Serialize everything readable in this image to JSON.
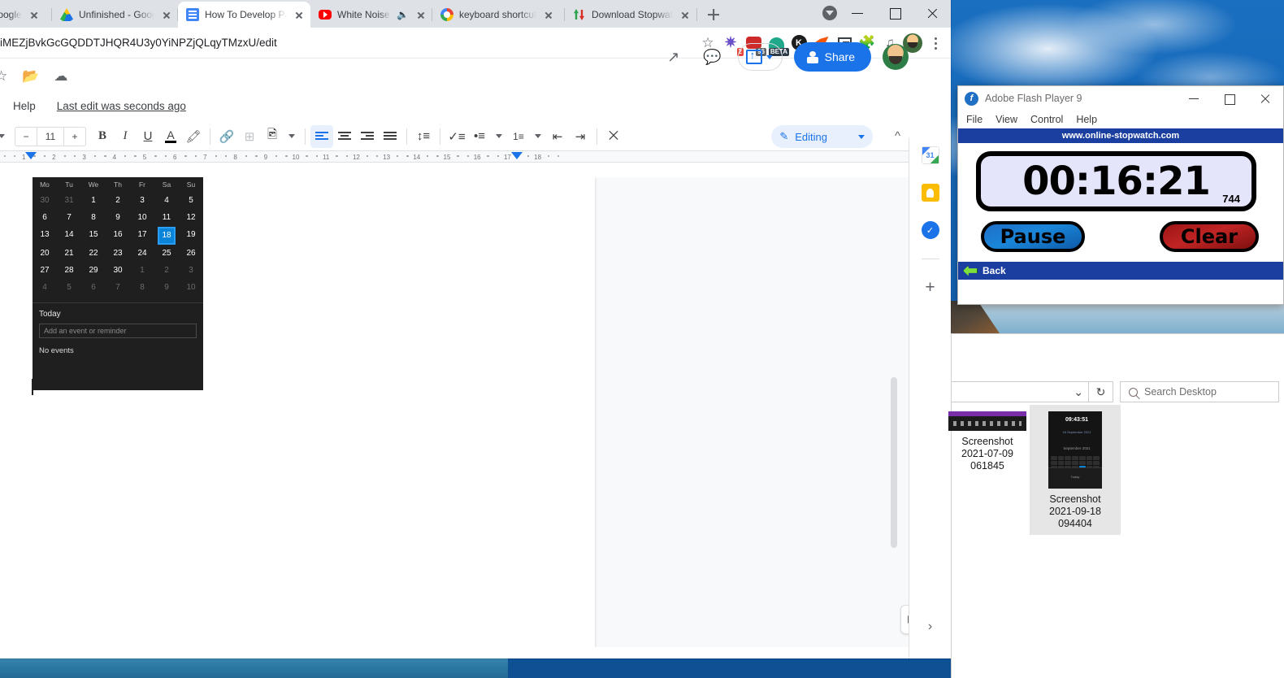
{
  "browser": {
    "tabs": [
      {
        "title": "rive - Google",
        "favicon": "none",
        "active": false
      },
      {
        "title": "Unfinished - Googl",
        "favicon": "google-drive-icon",
        "active": false
      },
      {
        "title": "How To Develop Pa",
        "favicon": "google-docs-icon",
        "active": true
      },
      {
        "title": "White Noise Bl",
        "favicon": "youtube-icon",
        "active": false,
        "audio": true
      },
      {
        "title": "keyboard shortcut",
        "favicon": "google-icon",
        "active": false
      },
      {
        "title": "Download Stopwat",
        "favicon": "download-icon",
        "active": false
      }
    ],
    "new_tab_label": "+",
    "url": "iMEZjBvkGcGQDDTJHQR4U3y0YiNPZjQLqyTMzxU/edit",
    "extensions": [
      {
        "name": "star-icon",
        "glyph": "☆",
        "color": "#5f6368"
      },
      {
        "name": "snowflake-extension-icon",
        "glyph": "✹",
        "color": "#6b4fc9",
        "badge": "2",
        "badge_color": "#e8453c"
      },
      {
        "name": "grammar-extension-icon",
        "glyph": "",
        "color": "#cf2a2a",
        "badge": "96",
        "badge_color": "#5f6368"
      },
      {
        "name": "beta-extension-icon",
        "glyph": "",
        "color": "#1fa88a",
        "badge": "BETA",
        "badge_color": "#2d3a4a"
      },
      {
        "name": "kami-extension-icon",
        "glyph": "K",
        "color": "#1c1c1c"
      },
      {
        "name": "orange-pin-extension-icon",
        "glyph": "",
        "color": "#f4560a"
      },
      {
        "name": "picture-in-picture-icon",
        "glyph": "",
        "color": "#3c4043"
      },
      {
        "name": "puzzle-extensions-icon",
        "glyph": "",
        "color": "#5f6368"
      },
      {
        "name": "playlist-icon",
        "glyph": "",
        "color": "#5f6368"
      },
      {
        "name": "profile-avatar",
        "glyph": "",
        "color": "#f0b429"
      },
      {
        "name": "chrome-menu-icon",
        "glyph": "",
        "color": "#5f6368"
      }
    ]
  },
  "docs": {
    "header_icons": [
      "star-icon",
      "move-to-folder-icon",
      "cloud-saved-icon"
    ],
    "menu": {
      "help": "Help",
      "last_edit": "Last edit was seconds ago"
    },
    "header_right": {
      "activity_label": "activity-dashboard",
      "comment_label": "comment-history",
      "upload_label": "upload",
      "share_label": "Share"
    },
    "toolbar": {
      "font_size": "11",
      "minus": "−",
      "plus": "+",
      "bold": "B",
      "italic": "I",
      "underline": "U",
      "text_color": "A",
      "highlight": "highlight-icon",
      "link": "link-icon",
      "comment": "add-comment-icon",
      "image": "insert-image-icon",
      "align_left": "align-left-icon",
      "align_center": "align-center-icon",
      "align_right": "align-right-icon",
      "align_justify": "align-justify-icon",
      "line_spacing": "line-spacing-icon",
      "checklist": "checklist-icon",
      "bullet_list": "bulleted-list-icon",
      "numbered_list": "numbered-list-icon",
      "indent_less": "decrease-indent-icon",
      "indent_more": "increase-indent-icon",
      "clear_format": "clear-formatting-icon"
    },
    "mode": {
      "label": "Editing",
      "icon": "pencil-icon"
    },
    "ruler": {
      "numbers": [
        "1",
        "2",
        "3",
        "4",
        "5",
        "6",
        "7",
        "8",
        "9",
        "10",
        "11",
        "12",
        "13",
        "14",
        "15",
        "16",
        "17",
        "18"
      ],
      "left_margin_marker": 38,
      "right_margin_marker": 636
    },
    "sidepanel": [
      {
        "name": "google-calendar-icon",
        "label": "31",
        "color": "#4285f4"
      },
      {
        "name": "google-keep-icon",
        "label": "",
        "color": "#fbbc04"
      },
      {
        "name": "google-tasks-icon",
        "label": "",
        "color": "#1a73e8"
      },
      {
        "name": "add-on-plus-icon",
        "label": "+",
        "color": "#5f6368"
      }
    ],
    "explore_button": "explore-icon",
    "expand_panel": "›"
  },
  "doc_content": {
    "calendar_image": {
      "weekdays": [
        "Mo",
        "Tu",
        "We",
        "Th",
        "Fr",
        "Sa",
        "Su"
      ],
      "weeks": [
        [
          {
            "d": "30",
            "dim": true
          },
          {
            "d": "31",
            "dim": true
          },
          {
            "d": "1"
          },
          {
            "d": "2"
          },
          {
            "d": "3"
          },
          {
            "d": "4"
          },
          {
            "d": "5"
          }
        ],
        [
          {
            "d": "6"
          },
          {
            "d": "7"
          },
          {
            "d": "8"
          },
          {
            "d": "9"
          },
          {
            "d": "10"
          },
          {
            "d": "11"
          },
          {
            "d": "12"
          }
        ],
        [
          {
            "d": "13"
          },
          {
            "d": "14"
          },
          {
            "d": "15"
          },
          {
            "d": "16"
          },
          {
            "d": "17"
          },
          {
            "d": "18",
            "selected": true
          },
          {
            "d": "19"
          }
        ],
        [
          {
            "d": "20"
          },
          {
            "d": "21"
          },
          {
            "d": "22"
          },
          {
            "d": "23"
          },
          {
            "d": "24"
          },
          {
            "d": "25"
          },
          {
            "d": "26"
          }
        ],
        [
          {
            "d": "27"
          },
          {
            "d": "28"
          },
          {
            "d": "29"
          },
          {
            "d": "30"
          },
          {
            "d": "1",
            "dim": true
          },
          {
            "d": "2",
            "dim": true
          },
          {
            "d": "3",
            "dim": true
          }
        ],
        [
          {
            "d": "4",
            "dim": true
          },
          {
            "d": "5",
            "dim": true
          },
          {
            "d": "6",
            "dim": true
          },
          {
            "d": "7",
            "dim": true
          },
          {
            "d": "8",
            "dim": true
          },
          {
            "d": "9",
            "dim": true
          },
          {
            "d": "10",
            "dim": true
          }
        ]
      ],
      "today_label": "Today",
      "event_placeholder": "Add an event or reminder",
      "no_events": "No events"
    }
  },
  "flash_player": {
    "title": "Adobe Flash Player 9",
    "menu": [
      "File",
      "View",
      "Control",
      "Help"
    ],
    "banner": "www.online-stopwatch.com",
    "stopwatch": {
      "time": "00:16:21",
      "milliseconds": "744",
      "pause_label": "Pause",
      "clear_label": "Clear"
    },
    "back_label": "Back",
    "window_controls": {
      "minimize": "minimize-icon",
      "maximize": "maximize-icon",
      "close": "close-icon"
    }
  },
  "explorer": {
    "search_placeholder": "Search Desktop",
    "refresh_label": "refresh-icon",
    "dropdown_label": "chevron-down-icon",
    "files": [
      {
        "name": "Screenshot\n2021-07-09\n061845",
        "line1": "Screenshot",
        "line2": "2021-07-09",
        "line3": "061845",
        "selected": false,
        "thumb": "dark-taskbar-thumb"
      },
      {
        "name": "Screenshot\n2021-09-18\n094404",
        "line1": "Screenshot",
        "line2": "2021-09-18",
        "line3": "094404",
        "selected": true,
        "thumb": "calendar-thumb"
      }
    ],
    "thumb_calendar": {
      "time": "09:43:51",
      "date": "18 September 2021"
    }
  },
  "colors": {
    "chrome_tabstrip": "#dee1e6",
    "docs_blue": "#1a73e8",
    "flash_banner_blue": "#1b3fa0",
    "stopwatch_bg": "#e4e4fa",
    "pause_blue": "#1a86d8",
    "clear_red": "#c02424",
    "calendar_selected": "#0a84d8",
    "desktop_blue": "#0e5fa8"
  }
}
